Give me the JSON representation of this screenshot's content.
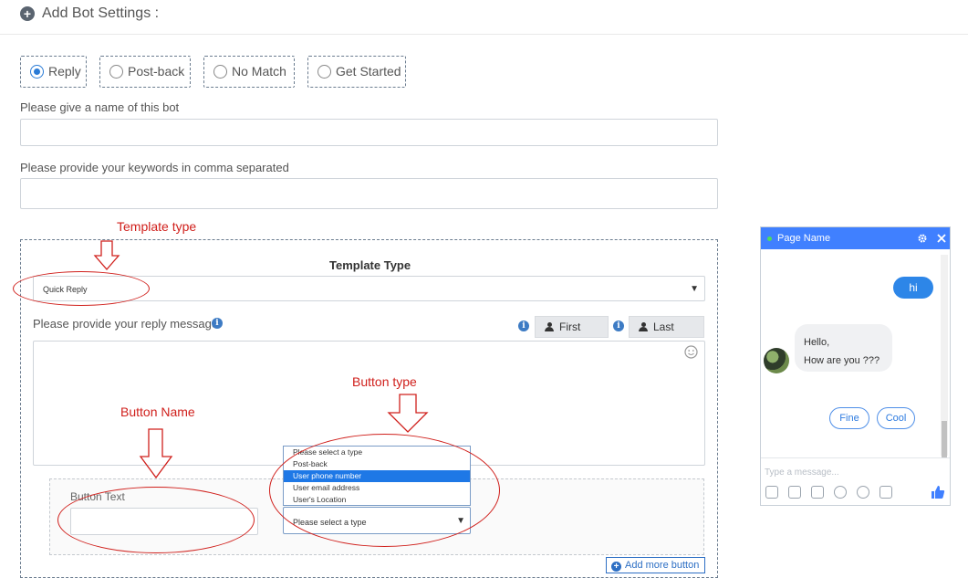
{
  "header": {
    "title": "Add Bot Settings :"
  },
  "bot_types": [
    {
      "label": "Reply",
      "selected": true
    },
    {
      "label": "Post-back",
      "selected": false
    },
    {
      "label": "No Match",
      "selected": false
    },
    {
      "label": "Get Started",
      "selected": false
    }
  ],
  "form": {
    "name_label": "Please give a name of this bot",
    "name_value": "",
    "keywords_label": "Please provide your keywords in comma separated",
    "keywords_value": ""
  },
  "template": {
    "heading": "Template Type",
    "selected": "Quick Reply",
    "message_label": "Please provide your reply message",
    "first_name_btn": "First Name",
    "last_name_btn": "Last Name",
    "message_value": ""
  },
  "button_row": {
    "button_text_label": "Button Text",
    "button_text_value": "",
    "type_placeholder": "Please select a type",
    "type_options": [
      {
        "label": "Please select a type",
        "highlighted": false
      },
      {
        "label": "Post-back",
        "highlighted": false
      },
      {
        "label": "User phone number",
        "highlighted": true
      },
      {
        "label": "User email address",
        "highlighted": false
      },
      {
        "label": "User's Location",
        "highlighted": false
      }
    ],
    "add_more_label": "Add more button"
  },
  "annotations": {
    "template_type": "Template type",
    "button_name": "Button Name",
    "button_type": "Button type"
  },
  "chat_preview": {
    "page_name": "Page Name",
    "user_message": "hi",
    "bot_message_line1": "Hello,",
    "bot_message_line2": "How are you  ???",
    "quick_replies": [
      "Fine",
      "Cool"
    ],
    "input_placeholder": "Type a message...",
    "colors": {
      "header": "#4080ff",
      "user_bubble": "#2d86e8",
      "online": "#4fdc5c"
    },
    "toolbar_icons": [
      "image-icon",
      "sticker-icon",
      "gif-icon",
      "emoji-icon",
      "attachment-icon",
      "camera-icon"
    ]
  },
  "colors": {
    "annotation": "#d0201c",
    "accent": "#2a7bd6"
  }
}
